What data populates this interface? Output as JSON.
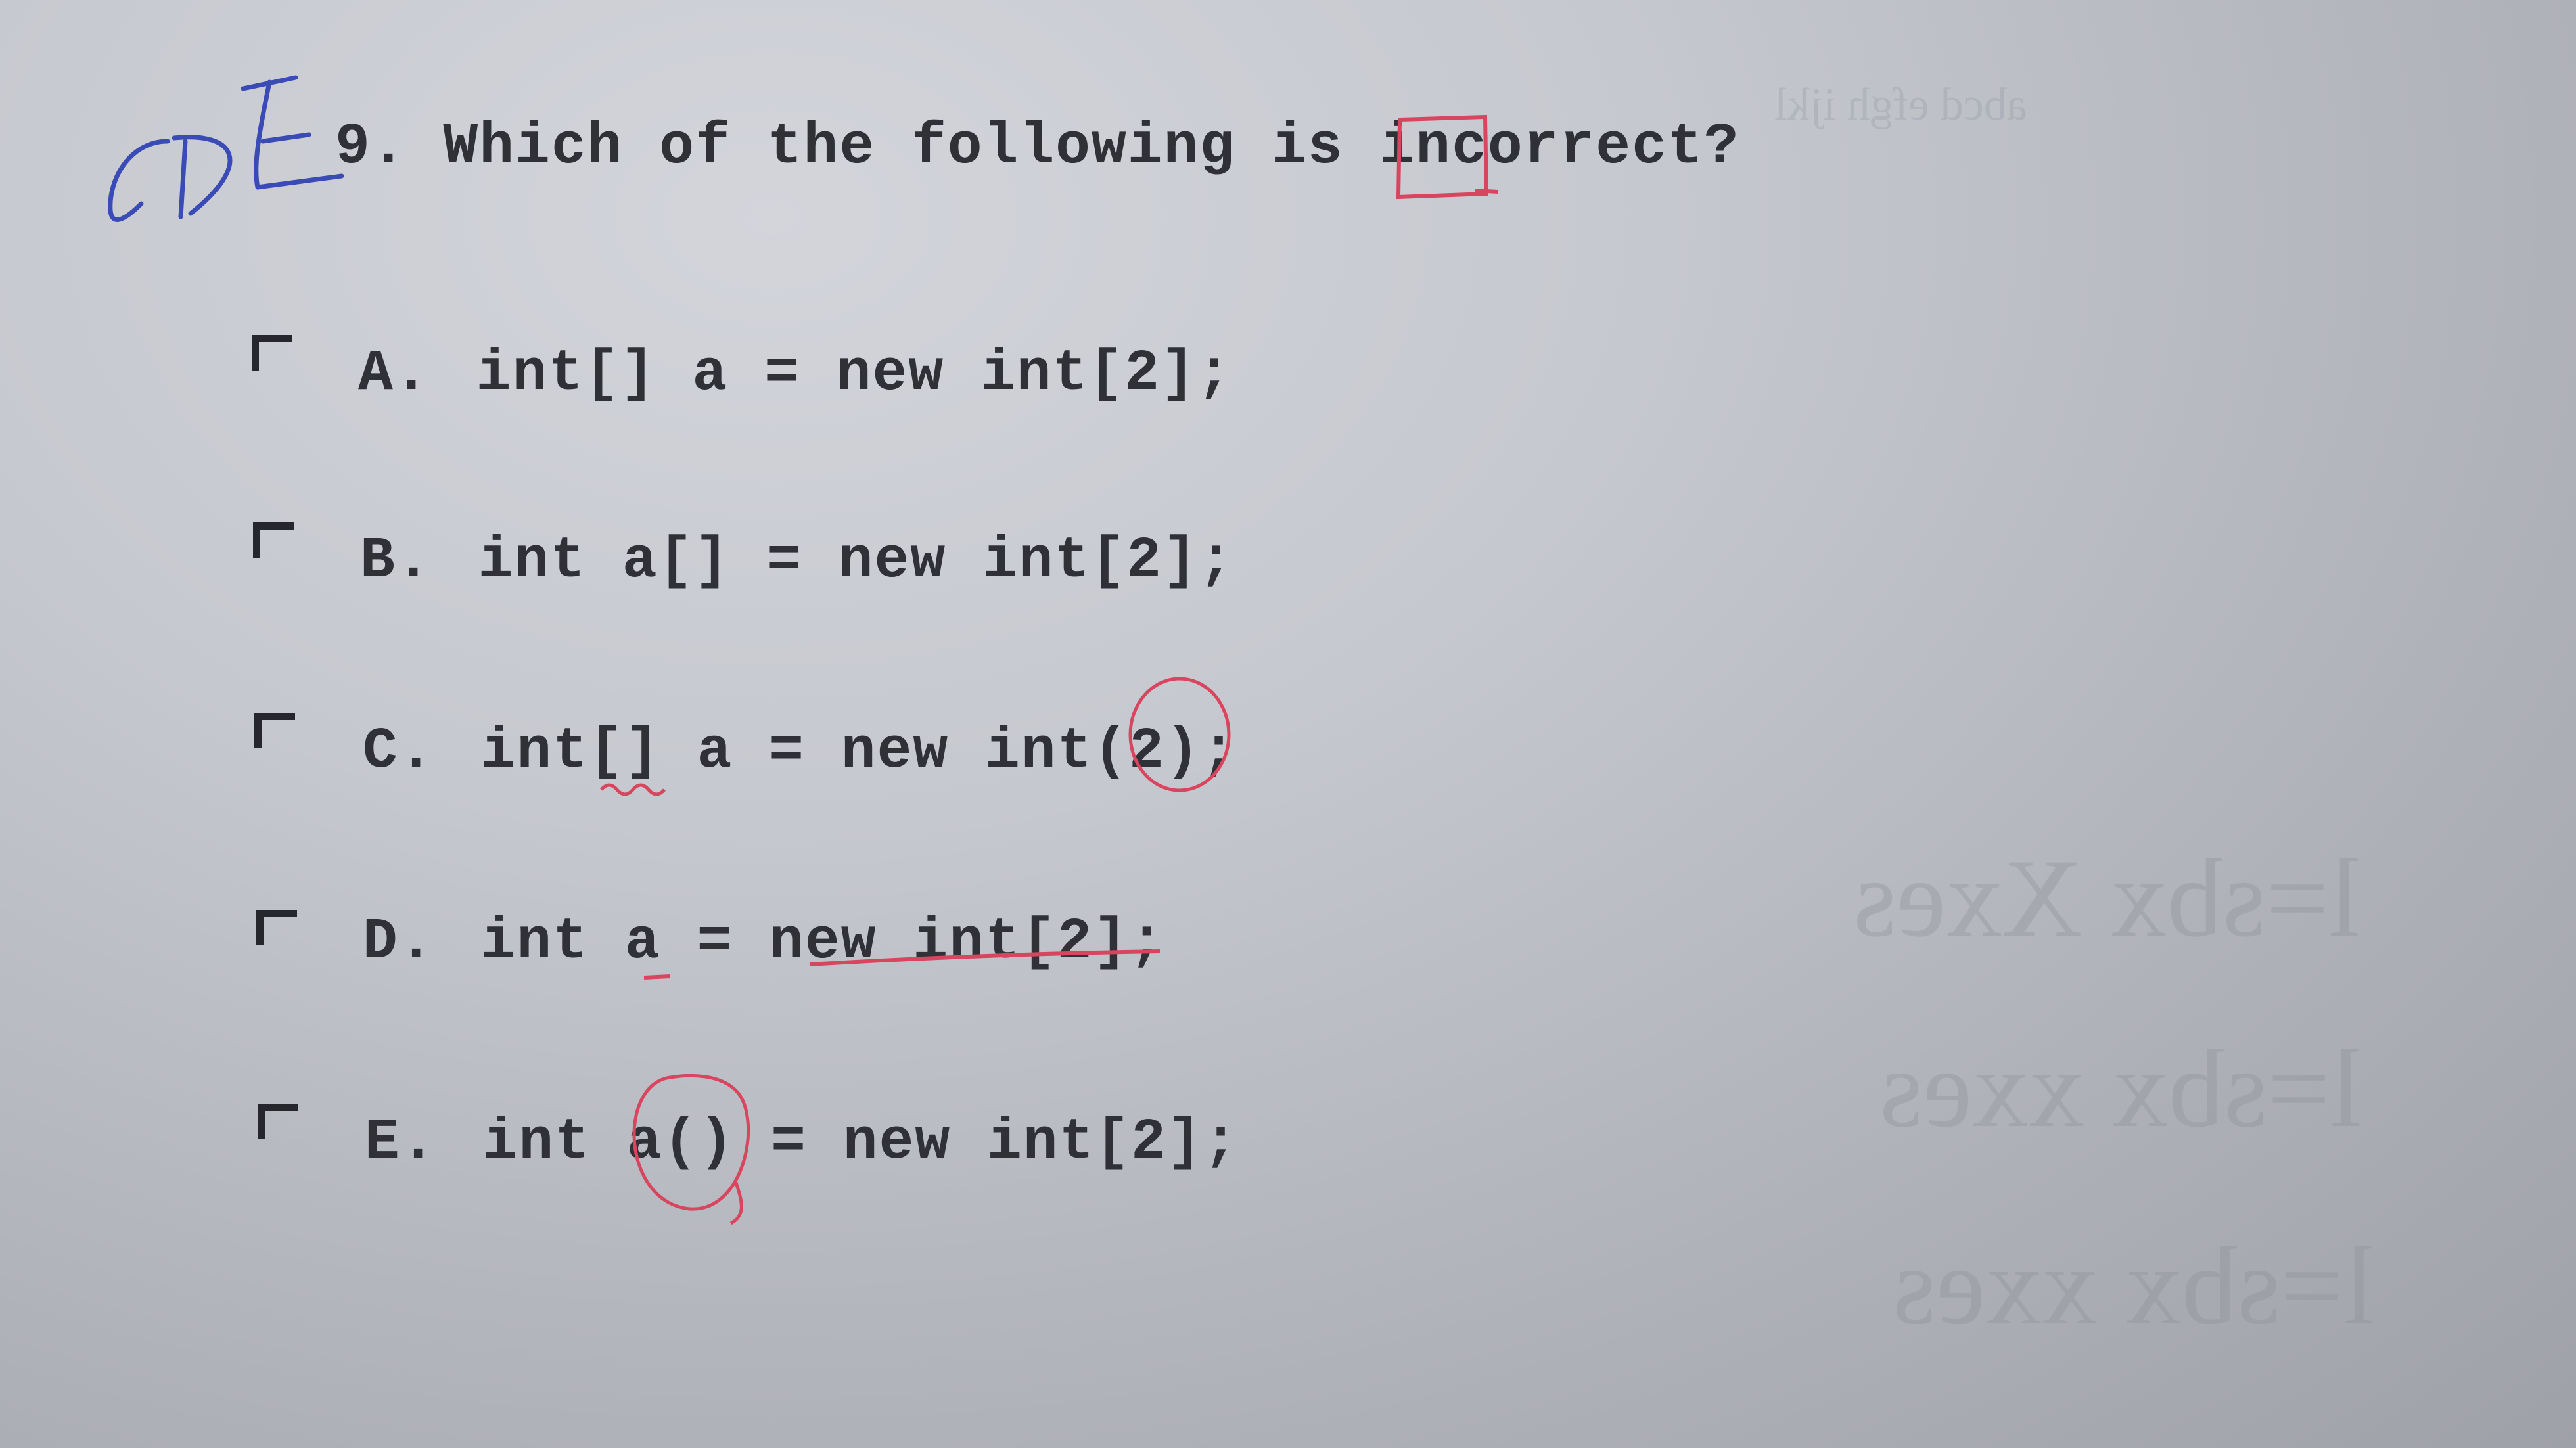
{
  "question": {
    "text": "9. Which of the following is incorrect?"
  },
  "handwritten_note": "CDE",
  "options": [
    {
      "letter": "A.",
      "code": "int[] a = new int[2];"
    },
    {
      "letter": "B.",
      "code": "int a[] = new int[2];"
    },
    {
      "letter": "C.",
      "code": "int[] a = new int(2);"
    },
    {
      "letter": "D.",
      "code": "int a = new int[2];"
    },
    {
      "letter": "E.",
      "code": "int a() = new int[2];"
    }
  ],
  "colors": {
    "ink": "#2f3137",
    "pen_blue": "#3a4bb6",
    "pen_red": "#d8455e",
    "checkbox": "#25272c"
  }
}
